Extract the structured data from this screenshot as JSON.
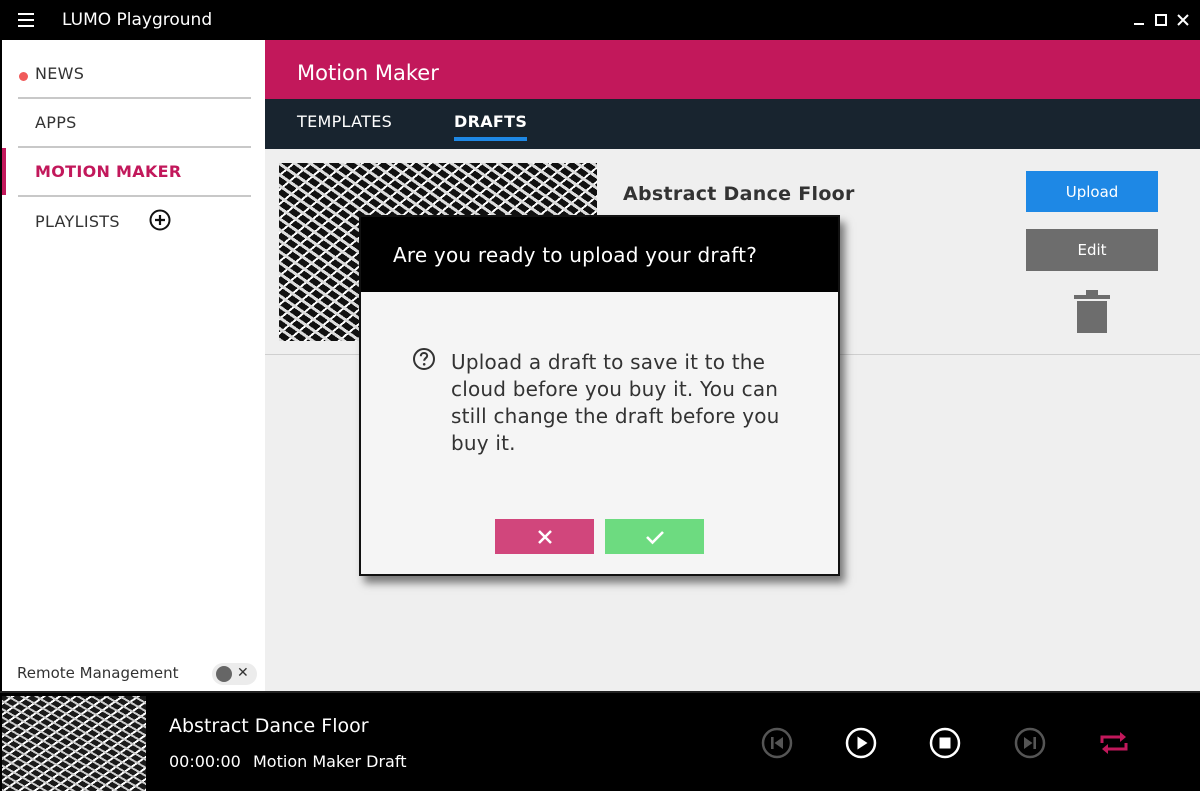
{
  "window": {
    "title": "LUMO Playground"
  },
  "sidebar": {
    "items": [
      {
        "label": "NEWS"
      },
      {
        "label": "APPS"
      },
      {
        "label": "MOTION MAKER"
      },
      {
        "label": "PLAYLISTS"
      }
    ],
    "remote_label": "Remote Management"
  },
  "main": {
    "title": "Motion Maker",
    "tabs": [
      {
        "label": "TEMPLATES"
      },
      {
        "label": "DRAFTS"
      }
    ],
    "draft": {
      "title": "Abstract Dance Floor",
      "upload_label": "Upload",
      "edit_label": "Edit"
    }
  },
  "modal": {
    "title": "Are you ready to upload your draft?",
    "body": "Upload a draft to save it to the cloud before you buy it. You can still change the draft before you buy it."
  },
  "player": {
    "title": "Abstract Dance Floor",
    "time": "00:00:00",
    "subtitle": "Motion Maker Draft"
  },
  "colors": {
    "accent": "#c2185b",
    "tab_bar": "#18242f",
    "upload": "#1e88e5",
    "cancel": "#d1467c",
    "confirm": "#6ddb80"
  }
}
